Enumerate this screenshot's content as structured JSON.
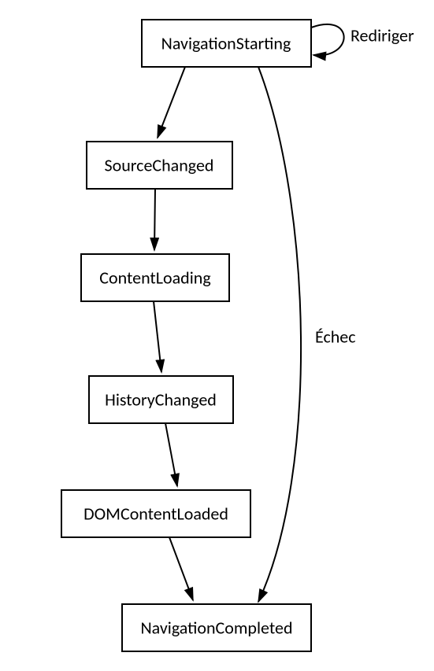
{
  "nodes": {
    "navigation_starting": "NavigationStarting",
    "source_changed": "SourceChanged",
    "content_loading": "ContentLoading",
    "history_changed": "HistoryChanged",
    "dom_content_loaded": "DOMContentLoaded",
    "navigation_completed": "NavigationCompleted"
  },
  "labels": {
    "redirect": "Rediriger",
    "failure": "Échec"
  }
}
